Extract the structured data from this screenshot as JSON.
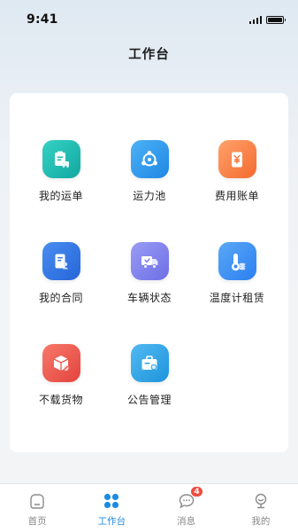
{
  "status_bar": {
    "time": "9:41"
  },
  "header": {
    "title": "工作台"
  },
  "grid": {
    "items": [
      {
        "label": "我的运单",
        "icon": "waybill-icon",
        "color_from": "#35d1c4",
        "color_to": "#12a8a0"
      },
      {
        "label": "运力池",
        "icon": "capacity-pool-icon",
        "color_from": "#4cb2f5",
        "color_to": "#1f86e5"
      },
      {
        "label": "费用账单",
        "icon": "bill-icon",
        "color_from": "#ffa26b",
        "color_to": "#f46a2f"
      },
      {
        "label": "我的合同",
        "icon": "contract-icon",
        "color_from": "#4a8df0",
        "color_to": "#2566d8"
      },
      {
        "label": "车辆状态",
        "icon": "truck-icon",
        "color_from": "#9a9cf4",
        "color_to": "#6d6ee6"
      },
      {
        "label": "温度计租赁",
        "icon": "thermometer-icon",
        "color_from": "#5aa8f7",
        "color_to": "#2b7ff0"
      },
      {
        "label": "不载货物",
        "icon": "cargo-icon",
        "color_from": "#f77a6c",
        "color_to": "#e3433c"
      },
      {
        "label": "公告管理",
        "icon": "announcement-icon",
        "color_from": "#52b9f2",
        "color_to": "#1e94dc"
      }
    ]
  },
  "tabbar": {
    "tabs": [
      {
        "label": "首页",
        "icon": "home-icon",
        "active": false
      },
      {
        "label": "工作台",
        "icon": "workbench-icon",
        "active": true
      },
      {
        "label": "消息",
        "icon": "message-icon",
        "active": false,
        "badge": "4"
      },
      {
        "label": "我的",
        "icon": "profile-icon",
        "active": false
      }
    ]
  },
  "colors": {
    "accent": "#1e8be0",
    "badge": "#f04b3c",
    "inactive": "#888888"
  }
}
